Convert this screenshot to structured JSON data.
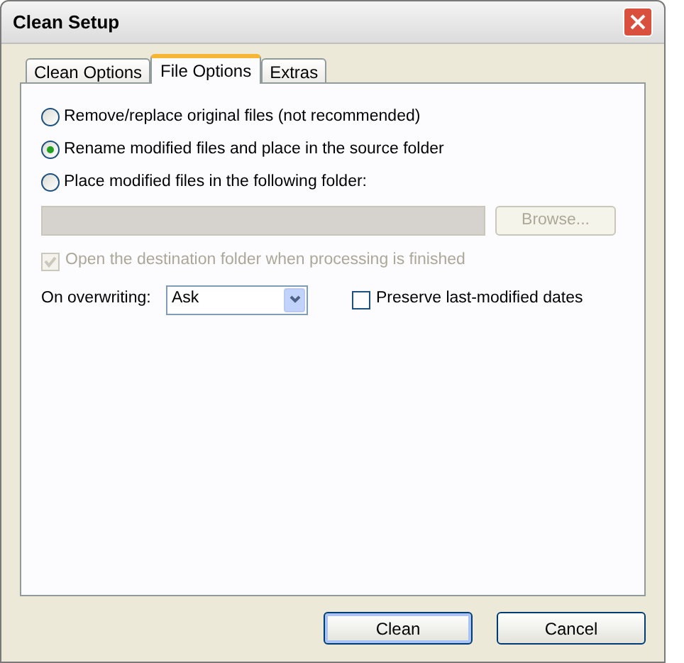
{
  "window": {
    "title": "Clean Setup"
  },
  "tabs": [
    {
      "label": "Clean Options",
      "selected": false
    },
    {
      "label": "File Options",
      "selected": true
    },
    {
      "label": "Extras",
      "selected": false
    }
  ],
  "file_handling": [
    {
      "label": "Remove/replace original files (not recommended)",
      "selected": false
    },
    {
      "label": "Rename modified files and place in the source folder",
      "selected": true
    },
    {
      "label": "Place modified files in the following folder:",
      "selected": false
    }
  ],
  "folder_field": {
    "disabled": true
  },
  "browse_button": {
    "label": "Browse...",
    "disabled": true
  },
  "open_folder": {
    "label": "Open the destination folder when processing is finished",
    "checked": true,
    "disabled": true
  },
  "on_overwriting": {
    "label": "On overwriting:",
    "value": "Ask"
  },
  "preserve_dates": {
    "label": "Preserve last-modified dates",
    "checked": false
  },
  "buttons": [
    {
      "label": "Clean",
      "default": true
    },
    {
      "label": "Cancel",
      "default": false
    }
  ]
}
